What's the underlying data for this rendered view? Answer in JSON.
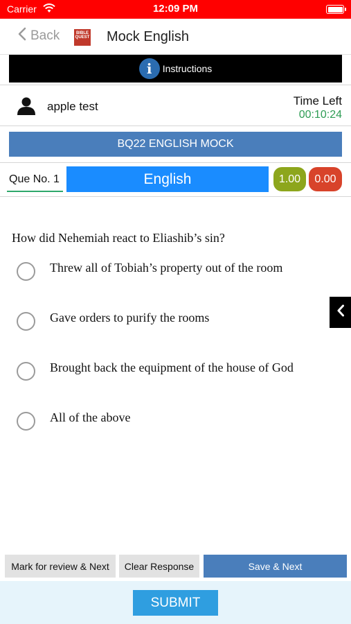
{
  "status_bar": {
    "carrier": "Carrier",
    "time": "12:09 PM",
    "wifi_icon": "wifi-icon",
    "battery_icon": "battery-icon"
  },
  "nav": {
    "back_label": "Back",
    "logo_text": "BIBLE QUEST",
    "title": "Mock English"
  },
  "instructions": {
    "label": "Instructions",
    "icon": "info-icon"
  },
  "user": {
    "name": "apple test",
    "time_left_label": "Time Left",
    "time_left_value": "00:10:24"
  },
  "exam": {
    "title": "BQ22 ENGLISH MOCK"
  },
  "question": {
    "number_label": "Que No. 1",
    "language": "English",
    "positive_marks": "1.00",
    "negative_marks": "0.00",
    "text": "How did Nehemiah react to Eliashib’s sin?",
    "options": [
      "Threw all of Tobiah’s property out of the room",
      "Gave orders to purify the rooms",
      "Brought back the equipment of the house of God",
      "All of the above"
    ]
  },
  "actions": {
    "mark_review": "Mark for review & Next",
    "clear_response": "Clear Response",
    "save_next": "Save & Next",
    "submit": "SUBMIT"
  },
  "colors": {
    "status_bar": "#ff0000",
    "language_tab": "#1a8cff",
    "positive_marks": "#8da61c",
    "negative_marks": "#d8432a",
    "exam_bar": "#4a7ebb",
    "timer": "#2e9c54",
    "submit": "#2f9ee0"
  }
}
